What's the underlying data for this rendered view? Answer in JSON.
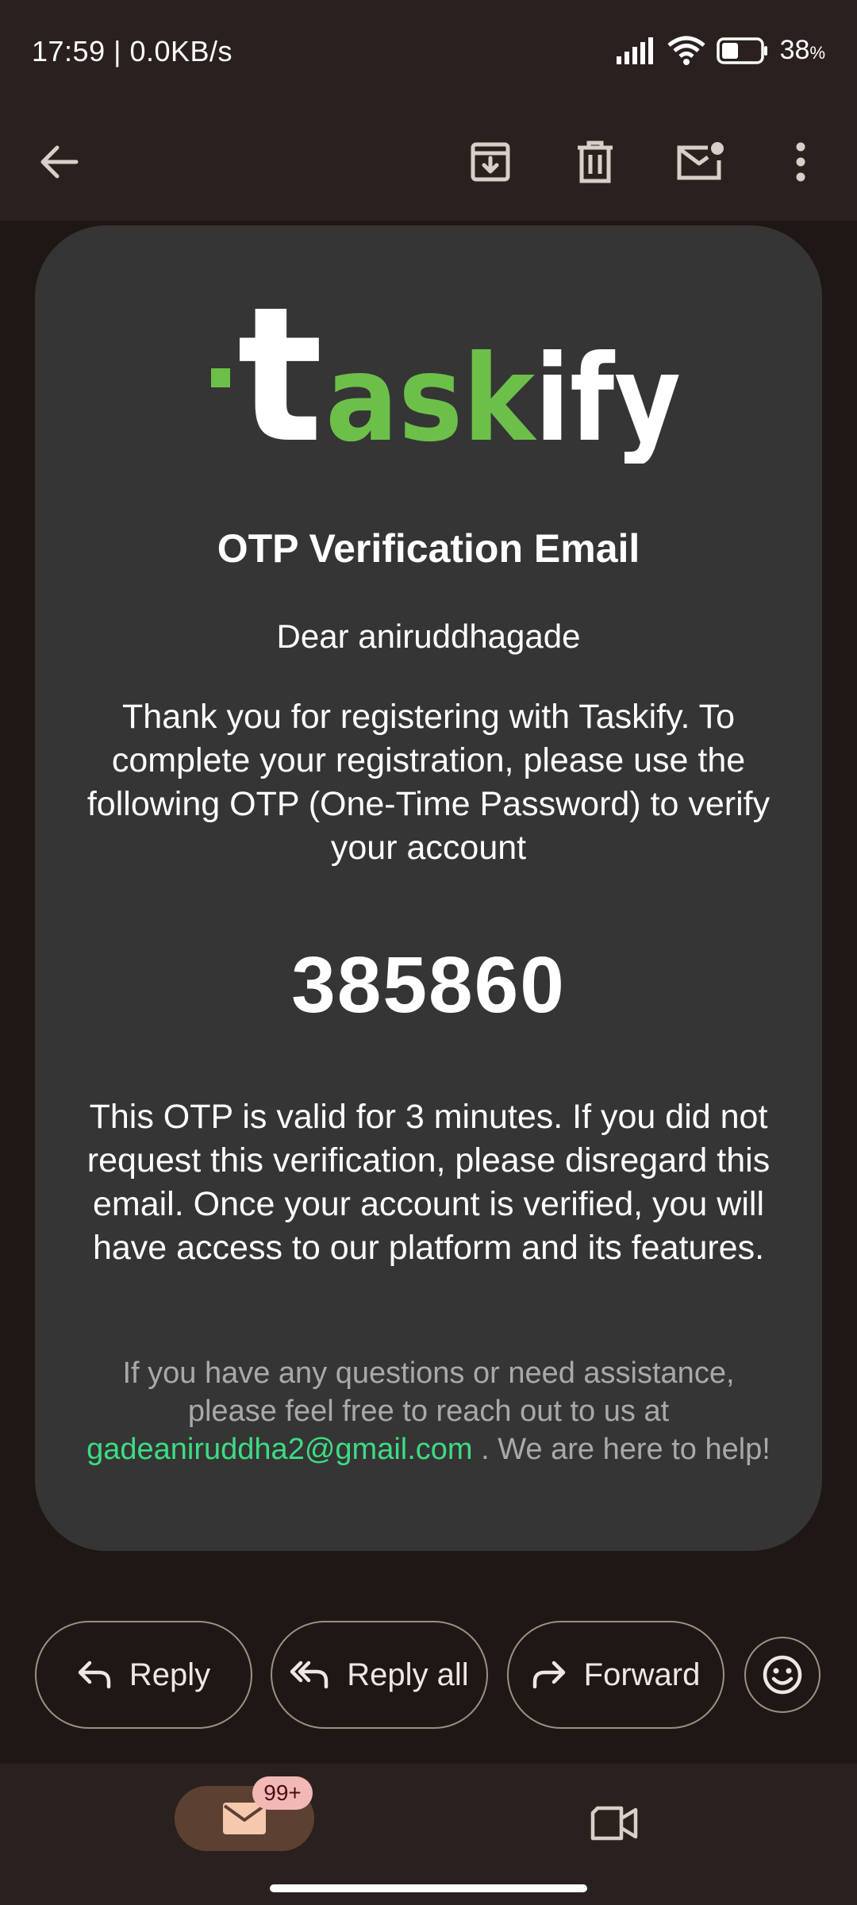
{
  "status_bar": {
    "time_speed": "17:59 | 0.0KB/s",
    "battery": "38",
    "battery_unit": "%"
  },
  "app_bar": {
    "back_icon": "arrow-left-icon",
    "archive_icon": "archive-icon",
    "delete_icon": "trash-icon",
    "mark_unread_icon": "mail-unread-icon",
    "more_icon": "more-vert-icon"
  },
  "email": {
    "logo": {
      "text_white": "t",
      "text_green": "ask",
      "text_white2": "ify",
      "green": "#6cc04a"
    },
    "title": "OTP Verification Email",
    "greeting": "Dear aniruddhagade",
    "intro": "Thank you for registering with Taskify. To complete your registration, please use the following OTP (One-Time Password) to verify your account",
    "otp": "385860",
    "validity": "This OTP is valid for 3 minutes. If you did not request this verification, please disregard this email. Once your account is verified, you will have access to our platform and its features.",
    "footer_before": "If you have any questions or need assistance, please feel free to reach out to us at",
    "footer_email": "gadeaniruddha2@gmail.com",
    "footer_after": ". We are here to help!"
  },
  "actions": {
    "reply": "Reply",
    "reply_all": "Reply all",
    "forward": "Forward",
    "emoji_icon": "emoji-smile-icon"
  },
  "bottom_nav": {
    "mail_badge": "99+",
    "mail_icon": "mail-icon",
    "meet_icon": "video-camera-icon"
  },
  "colors": {
    "background": "#1f1714",
    "card": "#353535",
    "link": "#3ddc84",
    "pill": "#5c4132",
    "badge": "#f2b8b5"
  }
}
